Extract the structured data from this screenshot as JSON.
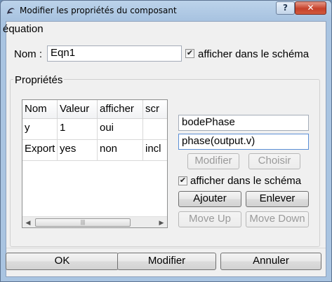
{
  "window": {
    "title": "Modifier les propriétés du composant",
    "help_label": "?",
    "close_label": "✕"
  },
  "component": {
    "type_label": "équation",
    "name_label": "Nom :",
    "name_value": "Eqn1",
    "show_in_schematic_checked": true,
    "show_in_schematic_label": "afficher dans le schéma"
  },
  "properties": {
    "group_title": "Propriétés",
    "columns": [
      "Nom",
      "Valeur",
      "afficher",
      "scr"
    ],
    "rows": [
      [
        "y",
        "1",
        "oui",
        ""
      ],
      [
        "Export",
        "yes",
        "non",
        "incl"
      ]
    ],
    "name_field": "bodePhase",
    "value_field": "phase(output.v)",
    "modify_label": "Modifier",
    "choose_label": "Choisir",
    "show_checked": true,
    "show_label": "afficher dans le schéma",
    "add_label": "Ajouter",
    "remove_label": "Enlever",
    "move_up_label": "Move Up",
    "move_down_label": "Move Down",
    "scroll_left_icon": "◀",
    "scroll_right_icon": "▶",
    "scroll_grip": "|||"
  },
  "footer": {
    "ok_label": "OK",
    "apply_label": "Modifier",
    "cancel_label": "Annuler"
  },
  "colors": {
    "frame": "#a9c4e1",
    "client": "#f0f0f0",
    "close": "#c6412a"
  }
}
